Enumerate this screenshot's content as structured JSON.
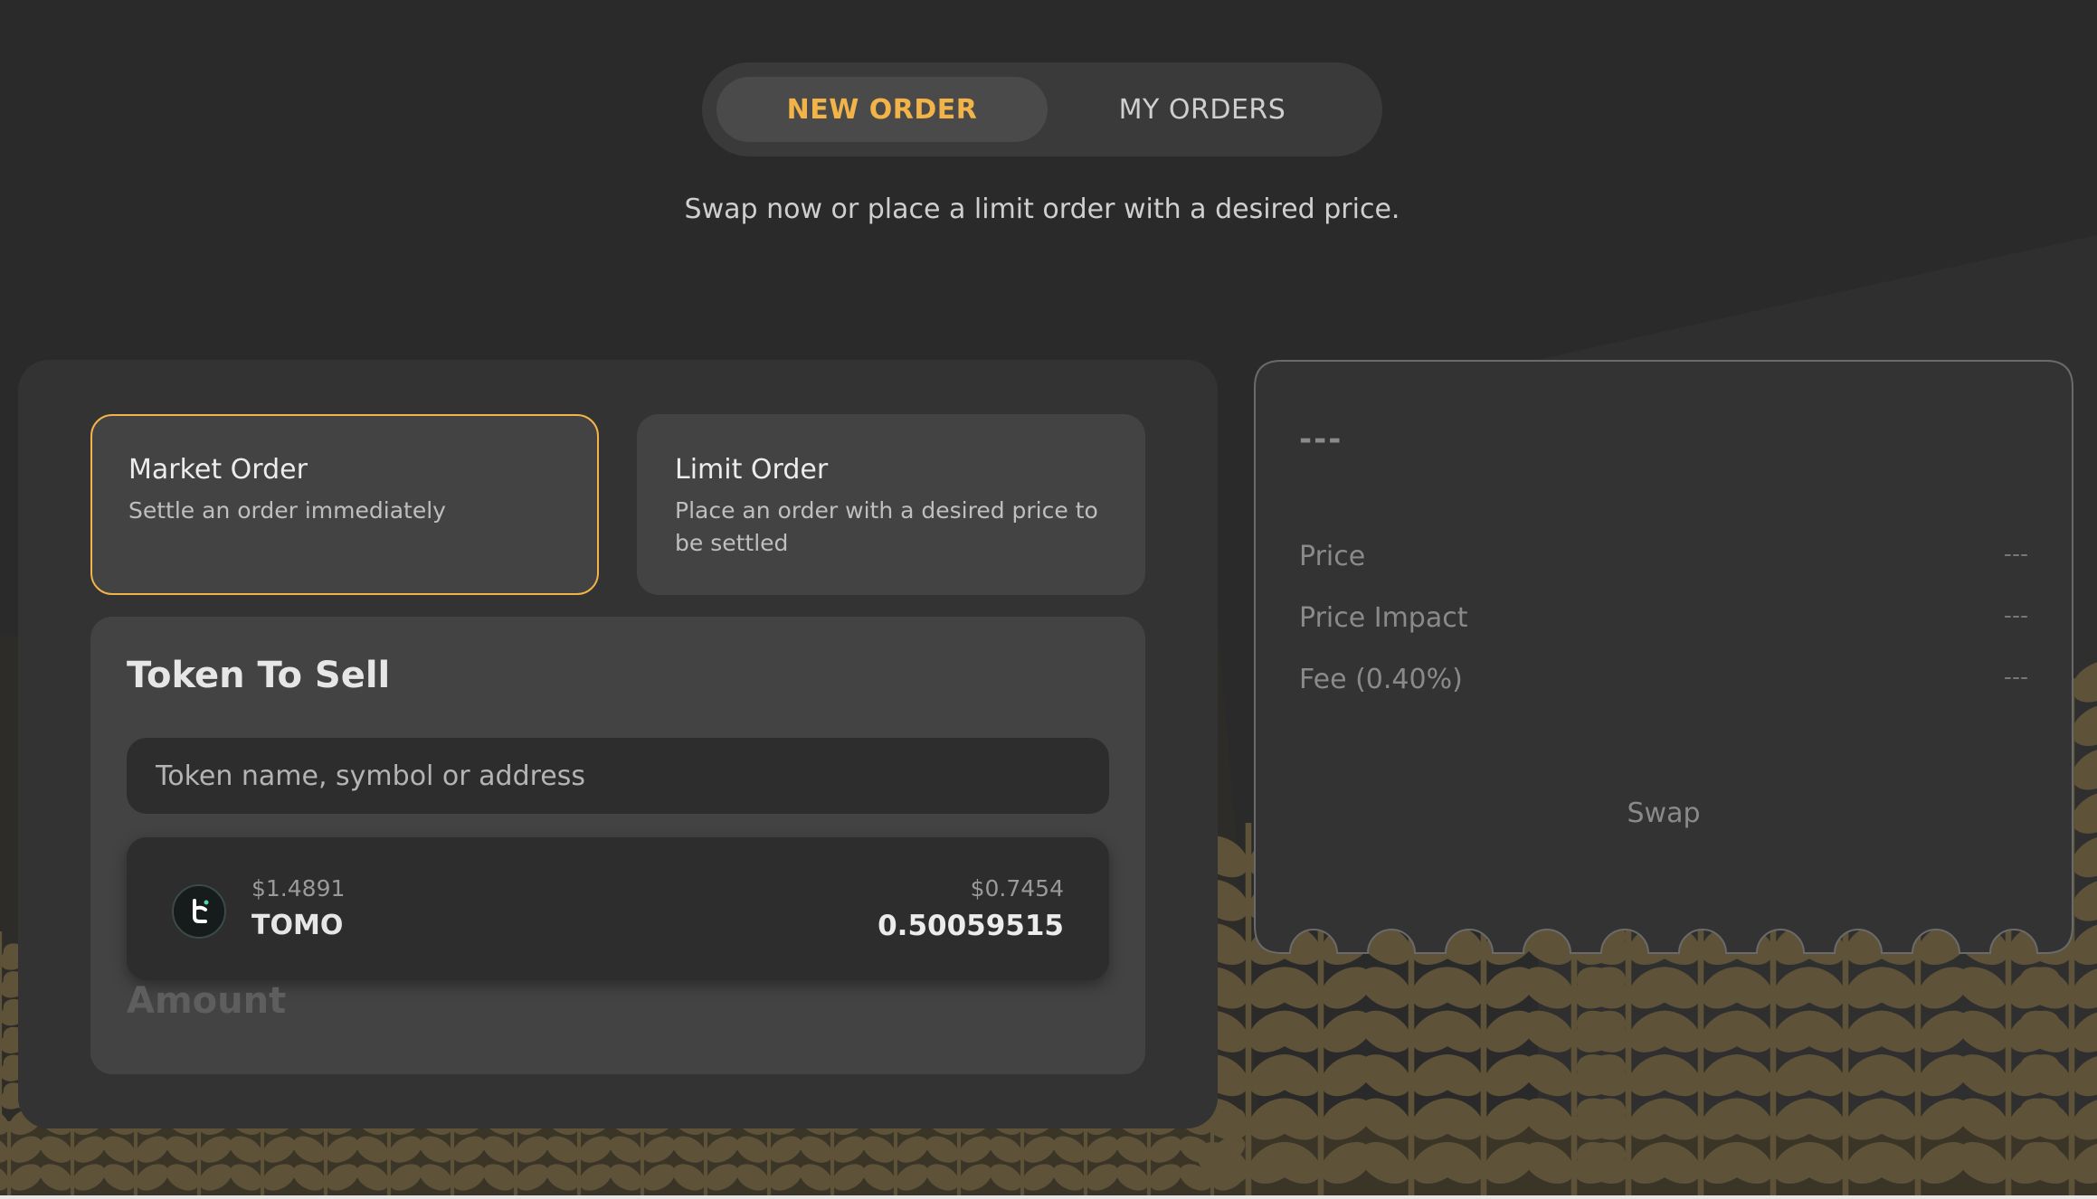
{
  "tabs": [
    {
      "label": "NEW ORDER",
      "active": true
    },
    {
      "label": "MY ORDERS",
      "active": false
    }
  ],
  "subtitle": "Swap now or place a limit order with a desired price.",
  "order_types": {
    "market": {
      "title": "Market Order",
      "desc": "Settle an order immediately",
      "selected": true
    },
    "limit": {
      "title": "Limit Order",
      "desc": "Place an order with a desired price to be settled",
      "selected": false
    }
  },
  "sell": {
    "title": "Token To Sell",
    "search_placeholder": "Token name, symbol or address",
    "token": {
      "icon": "tomo-logo-icon",
      "price": "$1.4891",
      "symbol": "TOMO",
      "usd_value": "$0.7454",
      "balance": "0.50059515"
    },
    "amount_label": "Amount"
  },
  "summary": {
    "route": "---",
    "rows": [
      {
        "label": "Price",
        "value": "---"
      },
      {
        "label": "Price Impact",
        "value": "---"
      },
      {
        "label": "Fee (0.40%)",
        "value": "---"
      }
    ],
    "swap_label": "Swap"
  },
  "colors": {
    "accent": "#f2b448",
    "background": "#2a2a2a",
    "card": "#333333",
    "panel": "#434343",
    "wheat": "#5e5238"
  }
}
